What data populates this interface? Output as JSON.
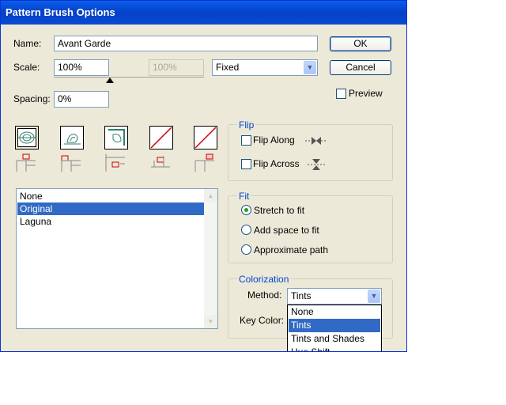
{
  "window": {
    "title": "Pattern Brush Options"
  },
  "name_field": {
    "label": "Name:",
    "value": "Avant Garde"
  },
  "scale": {
    "label": "Scale:",
    "value": "100%",
    "secondary_value": "100%",
    "mode": "Fixed"
  },
  "spacing": {
    "label": "Spacing:",
    "value": "0%"
  },
  "buttons": {
    "ok": "OK",
    "cancel": "Cancel"
  },
  "preview": {
    "label": "Preview",
    "checked": false
  },
  "tiles": [
    {
      "name": "side-tile",
      "selected": true
    },
    {
      "name": "outer-corner-tile",
      "selected": false
    },
    {
      "name": "inner-corner-tile",
      "selected": false
    },
    {
      "name": "start-tile",
      "selected": false
    },
    {
      "name": "end-tile",
      "selected": false
    }
  ],
  "pattern_list": {
    "items": [
      "None",
      "Original",
      "Laguna"
    ],
    "selected": "Original"
  },
  "flip": {
    "title": "Flip",
    "along": "Flip Along",
    "across": "Flip Across"
  },
  "fit": {
    "title": "Fit",
    "options": [
      "Stretch to fit",
      "Add space to fit",
      "Approximate path"
    ],
    "selected": "Stretch to fit"
  },
  "colorization": {
    "title": "Colorization",
    "method_label": "Method:",
    "method_value": "Tints",
    "key_color_label": "Key Color:",
    "dropdown_options": [
      "None",
      "Tints",
      "Tints and Shades",
      "Hue Shift"
    ],
    "dropdown_selected": "Tints"
  },
  "colors": {
    "titlebar": "#0a5ee8",
    "dialog_bg": "#ece9d8",
    "selection": "#316ac5",
    "group_title": "#0046d5"
  }
}
